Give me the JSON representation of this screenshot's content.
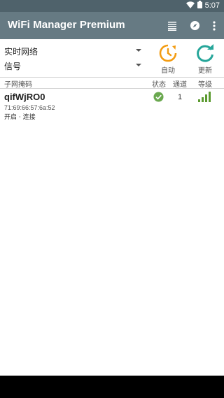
{
  "status_bar": {
    "time": "5:07",
    "icons": [
      "wifi-icon",
      "battery-icon"
    ]
  },
  "app_bar": {
    "title": "WiFi Manager Premium",
    "actions": [
      "list-view-icon",
      "compass-icon",
      "more-vert-icon"
    ]
  },
  "controls": {
    "view_select": "实时网络",
    "sort_select": "信号",
    "auto_label": "自动",
    "refresh_label": "更新",
    "auto_color": "#f39c12",
    "refresh_color": "#26a69a"
  },
  "table_header": {
    "subnet_mask": "子网掩码",
    "status": "状态",
    "channel": "通道",
    "level": "等级"
  },
  "networks": [
    {
      "ssid": "qifWjRO0",
      "mac": "71:69:66:57:6a:52",
      "security": "开启 · 连接",
      "status": "connected",
      "channel": "1",
      "signal_bars": 4,
      "status_color": "#6aa84f",
      "signal_color": "#5b9a2f"
    }
  ]
}
